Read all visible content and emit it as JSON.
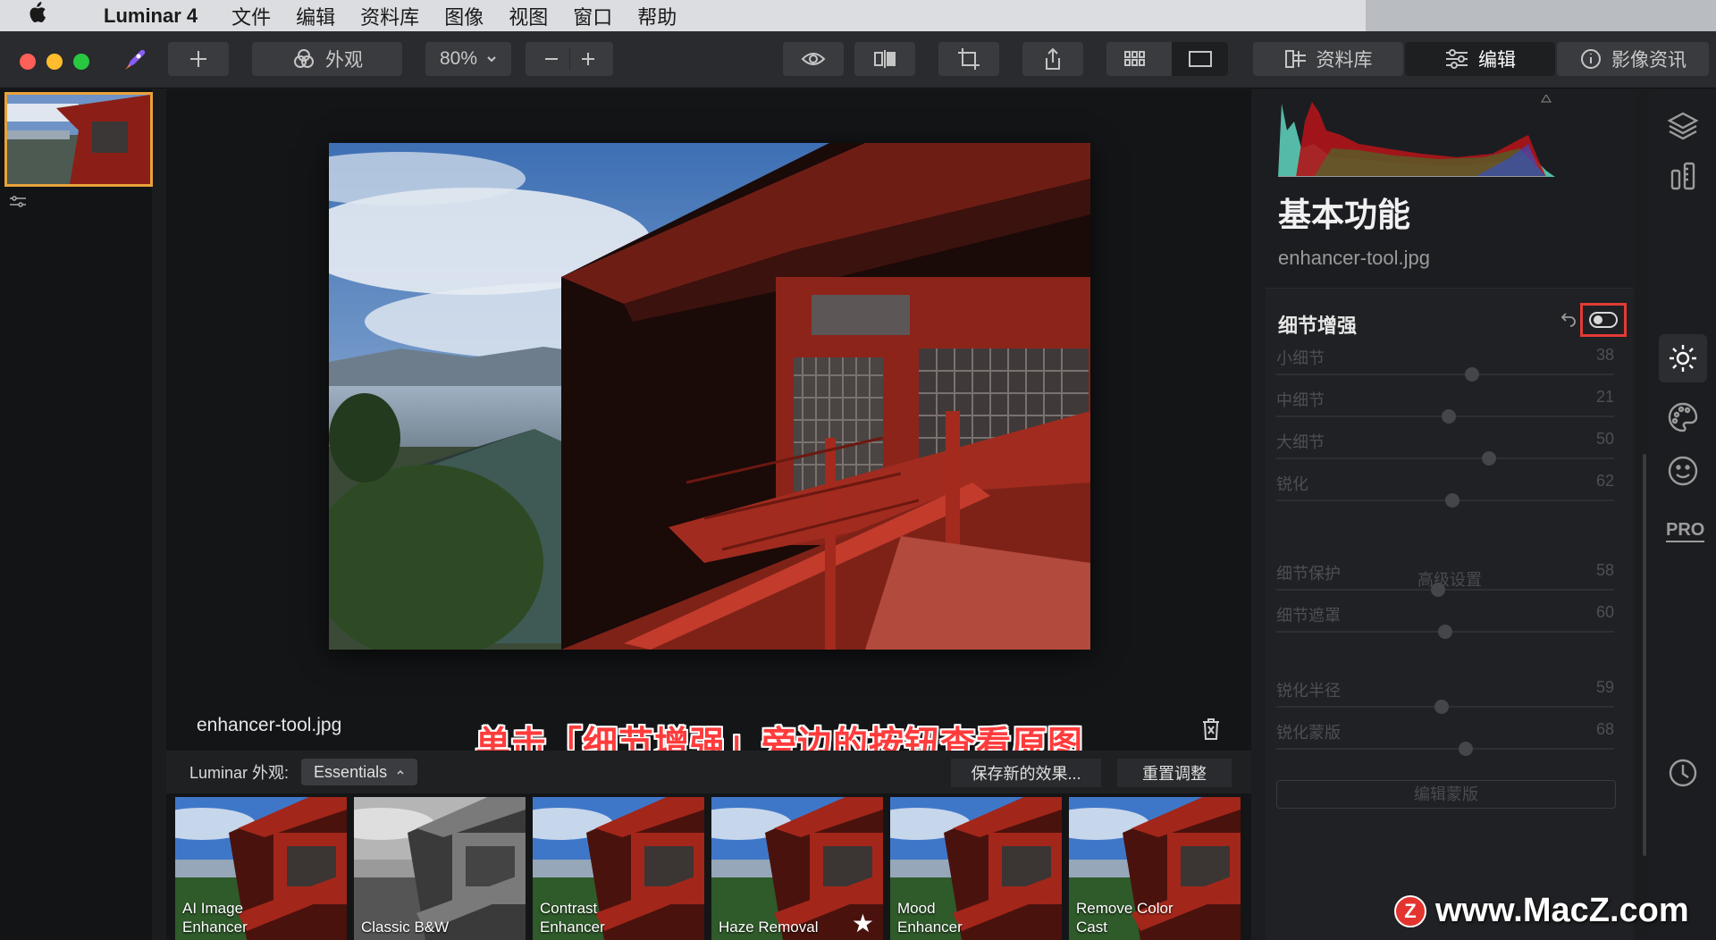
{
  "menubar": {
    "app_name": "Luminar 4",
    "items": [
      "文件",
      "编辑",
      "资料库",
      "图像",
      "视图",
      "窗口",
      "帮助"
    ]
  },
  "toolbar": {
    "looks_label": "外观",
    "zoom": "80%",
    "library_tab": "资料库",
    "edit_tab": "编辑",
    "info_tab": "影像资讯"
  },
  "image": {
    "filename": "enhancer-tool.jpg"
  },
  "caption": "单击「细节增强」旁边的按钮查看原图",
  "looks_bar": {
    "label": "Luminar 外观:",
    "selected": "Essentials",
    "save_label": "保存新的效果...",
    "reset_label": "重置调整"
  },
  "looks": [
    {
      "label": "AI Image\nEnhancer",
      "style": "color"
    },
    {
      "label": "Classic B&W",
      "style": "bw"
    },
    {
      "label": "Contrast\nEnhancer",
      "style": "color"
    },
    {
      "label": "Haze Removal",
      "style": "color",
      "favorite": true
    },
    {
      "label": "Mood\nEnhancer",
      "style": "color"
    },
    {
      "label": "Remove Color\nCast",
      "style": "color"
    }
  ],
  "panel": {
    "title": "基本功能",
    "filename": "enhancer-tool.jpg",
    "section_title": "细节增强",
    "sliders": [
      {
        "name": "小细节",
        "value": 38,
        "pos": 0.58
      },
      {
        "name": "中细节",
        "value": 21,
        "pos": 0.51
      },
      {
        "name": "大细节",
        "value": 50,
        "pos": 0.63
      },
      {
        "name": "锐化",
        "value": 62,
        "pos": 0.52
      }
    ],
    "advanced_label": "高级设置",
    "adv_sliders": [
      {
        "name": "细节保护",
        "value": 58,
        "pos": 0.48
      },
      {
        "name": "细节遮罩",
        "value": 60,
        "pos": 0.5
      }
    ],
    "adv_sliders2": [
      {
        "name": "锐化半径",
        "value": 59,
        "pos": 0.49
      },
      {
        "name": "锐化蒙版",
        "value": 68,
        "pos": 0.56
      }
    ],
    "edit_mask": "编辑蒙版"
  },
  "watermark": {
    "logo": "Z",
    "text": "www.MacZ.com"
  },
  "colors": {
    "accent": "#e9a23b",
    "highlight": "#e23b34"
  }
}
